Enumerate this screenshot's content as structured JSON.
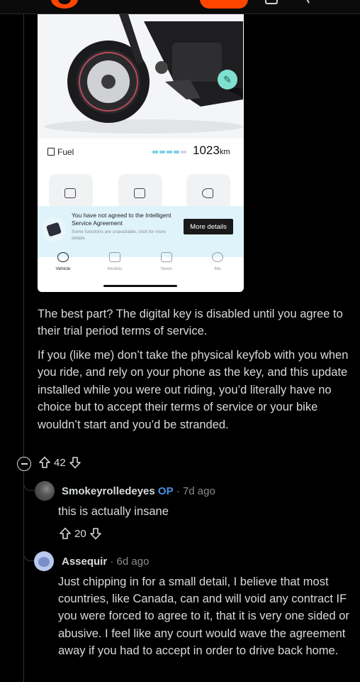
{
  "phone": {
    "fuel_label": "Fuel",
    "range_value": "1023",
    "range_unit": "km",
    "fuel_level_fraction": 0.8,
    "notice_title": "You have not agreed to the Intelligent Service Agreement",
    "notice_sub": "Some functions are unavailable, click for more details",
    "more_details": "More details",
    "tabs": [
      {
        "label": "Vehicle",
        "icon": "motorcycle-icon"
      },
      {
        "label": "Models",
        "icon": "models-icon"
      },
      {
        "label": "News",
        "icon": "news-icon"
      },
      {
        "label": "Me",
        "icon": "profile-icon"
      }
    ]
  },
  "comment": {
    "paragraph1": "The best part? The digital key is disabled until you agree to their trial period terms of service.",
    "paragraph2": "If you (like me) don’t take the physical keyfob with you when you ride, and rely on your phone as the key, and this update installed while you were out riding, you’d literally have no choice but to accept their terms of service or your bike wouldn’t start and you’d be stranded.",
    "votes": "42"
  },
  "replies": [
    {
      "author": "Smokeyrolledeyes",
      "badge": "OP",
      "time": " · 7d ago",
      "text": "this is actually insane",
      "votes": "20"
    },
    {
      "author": "Assequir",
      "time": " · 6d ago",
      "text": "Just chipping in for a small detail, I believe that most countries, like Canada, can and will void any contract IF you were forced to agree to it, that it is very one sided or abusive. I feel like any court would wave the agreement away if you had to accept in order to drive back home."
    }
  ],
  "colors": {
    "accent": "#ff4500",
    "op_badge": "#4a8fe7",
    "notice_bg": "#dff3fa"
  }
}
